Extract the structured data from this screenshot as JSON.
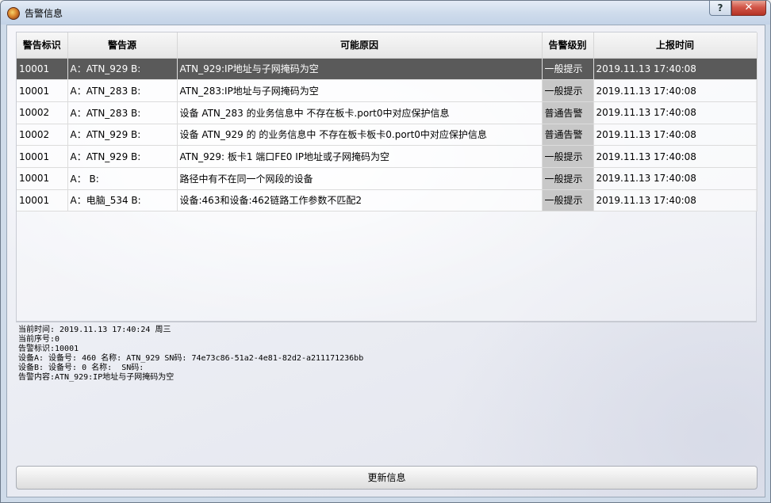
{
  "window": {
    "title": "告警信息",
    "help_label": "?",
    "close_label": "✕"
  },
  "table": {
    "columns": [
      "警告标识",
      "警告源",
      "可能原因",
      "告警级别",
      "上报时间"
    ],
    "rows": [
      {
        "id": "10001",
        "source": "A：ATN_929 B:",
        "cause": "ATN_929:IP地址与子网掩码为空",
        "level": "一般提示",
        "time": "2019.11.13 17:40:08"
      },
      {
        "id": "10001",
        "source": "A：ATN_283 B:",
        "cause": "ATN_283:IP地址与子网掩码为空",
        "level": "一般提示",
        "time": "2019.11.13 17:40:08"
      },
      {
        "id": "10002",
        "source": "A：ATN_283 B:",
        "cause": "设备 ATN_283 的业务信息中 不存在板卡.port0中对应保护信息",
        "level": "普通告警",
        "time": "2019.11.13 17:40:08"
      },
      {
        "id": "10002",
        "source": "A：ATN_929 B:",
        "cause": "设备 ATN_929 的 的业务信息中 不存在板卡板卡0.port0中对应保护信息",
        "level": "普通告警",
        "time": "2019.11.13 17:40:08"
      },
      {
        "id": "10001",
        "source": "A：ATN_929 B:",
        "cause": "ATN_929: 板卡1 端口FE0 IP地址或子网掩码为空",
        "level": "一般提示",
        "time": "2019.11.13 17:40:08"
      },
      {
        "id": "10001",
        "source": "A：  B:",
        "cause": "路径中有不在同一个网段的设备",
        "level": "一般提示",
        "time": "2019.11.13 17:40:08"
      },
      {
        "id": "10001",
        "source": "A：电脑_534 B:",
        "cause": "设备:463和设备:462链路工作参数不匹配2",
        "level": "一般提示",
        "time": "2019.11.13 17:40:08"
      }
    ],
    "selected_row": 0
  },
  "details": {
    "lines": [
      "当前时间: 2019.11.13 17:40:24 周三",
      "当前序号:0",
      "告警标识:10001",
      "设备A: 设备号: 460 名称: ATN_929 SN码: 74e73c86-51a2-4e81-82d2-a211171236bb",
      "设备B: 设备号: 0 名称:  SN码:",
      "告警内容:ATN_929:IP地址与子网掩码为空"
    ]
  },
  "footer": {
    "update_button_label": "更新信息"
  },
  "colors": {
    "selected_row_bg": "#5a5a5a",
    "level_cell_bg": "#c8c8c8"
  },
  "icons": [
    "app-icon",
    "help-icon",
    "close-icon"
  ]
}
